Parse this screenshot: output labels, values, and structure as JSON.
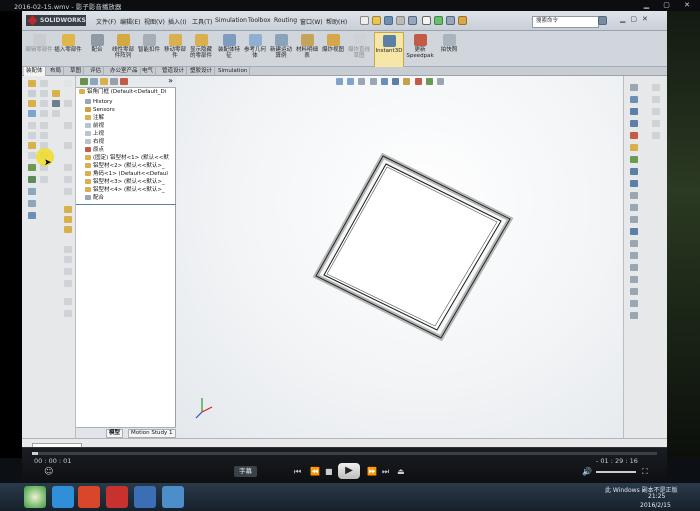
{
  "player": {
    "title": "2016-02-15.wmv - 影子影音播放器",
    "time_elapsed": "00 : 00 : 01",
    "time_remaining": "- 01 : 29 : 16",
    "subtitle_button": "字幕"
  },
  "sw": {
    "logo": "SOLIDWORKS",
    "menu": [
      "文件(F)",
      "编辑(E)",
      "视图(V)",
      "插入(I)",
      "工具(T)",
      "Simulation",
      "Toolbox",
      "Routing",
      "窗口(W)",
      "帮助(H)"
    ],
    "search_placeholder": "搜索命令",
    "commands": [
      {
        "label": "编辑零部件",
        "disabled": true
      },
      {
        "label": "插入零部件",
        "disabled": false
      },
      {
        "label": "配合",
        "disabled": false
      },
      {
        "label": "线性零部件阵列",
        "disabled": false
      },
      {
        "label": "智能扣件",
        "disabled": false
      },
      {
        "label": "移动零部件",
        "disabled": false
      },
      {
        "label": "显示隐藏的零部件",
        "disabled": false
      },
      {
        "label": "装配体特征",
        "disabled": false
      },
      {
        "label": "参考几何体",
        "disabled": false
      },
      {
        "label": "新建运动算例",
        "disabled": false
      },
      {
        "label": "材料明细表",
        "disabled": false
      },
      {
        "label": "爆炸视图",
        "disabled": false
      },
      {
        "label": "爆炸直线草图",
        "disabled": true
      },
      {
        "label": "Instant3D",
        "disabled": false,
        "active": true
      },
      {
        "label": "更新Speedpak",
        "disabled": false
      },
      {
        "label": "拍快照",
        "disabled": false
      }
    ],
    "tabs": [
      "装配体",
      "布局",
      "草图",
      "评估",
      "办公室产品",
      "电气",
      "管道设计",
      "塑胶设计",
      "Simulation"
    ],
    "selected_tab": "装配体",
    "tree": [
      "铝角门框 (Default<Default_Di",
      "History",
      "Sensors",
      "注解",
      "前视",
      "上视",
      "右视",
      "原点",
      "(固定) 铝型材<1> (默认<<默",
      "铝型材<2> (默认<<默认>_",
      "角码<1> (Default<<Defaul",
      "铝型材<3> (默认<<默认>_",
      "铝型材<4> (默认<<默认>_",
      "配合"
    ],
    "bottom_tabs": [
      "模型",
      "Motion Study 1"
    ]
  },
  "taskbar": {
    "watermark": "此 Windows 副本不是正版",
    "clock_time": "21:25",
    "clock_date": "2016/2/15"
  }
}
